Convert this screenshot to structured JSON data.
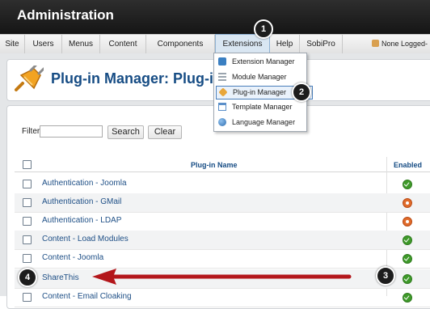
{
  "header": {
    "title": "Administration"
  },
  "menu": {
    "items": [
      "Site",
      "Users",
      "Menus",
      "Content",
      "Components",
      "Extensions",
      "Help",
      "SobiPro"
    ],
    "logged_in": "None Logged-in"
  },
  "extensions_dropdown": {
    "items": [
      {
        "label": "Extension Manager",
        "icon": "extension-icon",
        "color": "#3a7fc2"
      },
      {
        "label": "Module Manager",
        "icon": "module-icon",
        "color": "#9aa4ae"
      },
      {
        "label": "Plug-in Manager",
        "icon": "plugin-icon",
        "color": "#e8a63a"
      },
      {
        "label": "Template Manager",
        "icon": "template-icon",
        "color": "#5b8fc9"
      },
      {
        "label": "Language Manager",
        "icon": "language-icon",
        "color": "#4a86c5"
      }
    ]
  },
  "page": {
    "title": "Plug-in Manager: Plug-ins"
  },
  "filter": {
    "label": "Filter:",
    "value": "",
    "search_label": "Search",
    "clear_label": "Clear"
  },
  "table": {
    "columns": [
      "Plug-in Name",
      "Enabled"
    ],
    "rows": [
      {
        "name": "Authentication - Joomla",
        "enabled": true
      },
      {
        "name": "Authentication - GMail",
        "enabled": false
      },
      {
        "name": "Authentication - LDAP",
        "enabled": false
      },
      {
        "name": "Content - Load Modules",
        "enabled": true
      },
      {
        "name": "Content - Joomla",
        "enabled": true
      },
      {
        "name": "ShareThis",
        "enabled": true
      },
      {
        "name": "Content - Email Cloaking",
        "enabled": true
      }
    ]
  },
  "callouts": [
    "1",
    "2",
    "3",
    "4"
  ],
  "colors": {
    "arrow": "#b3161b",
    "link": "#1e4f86",
    "enabled": "#3f9a2a",
    "disabled": "#e06b2a"
  }
}
